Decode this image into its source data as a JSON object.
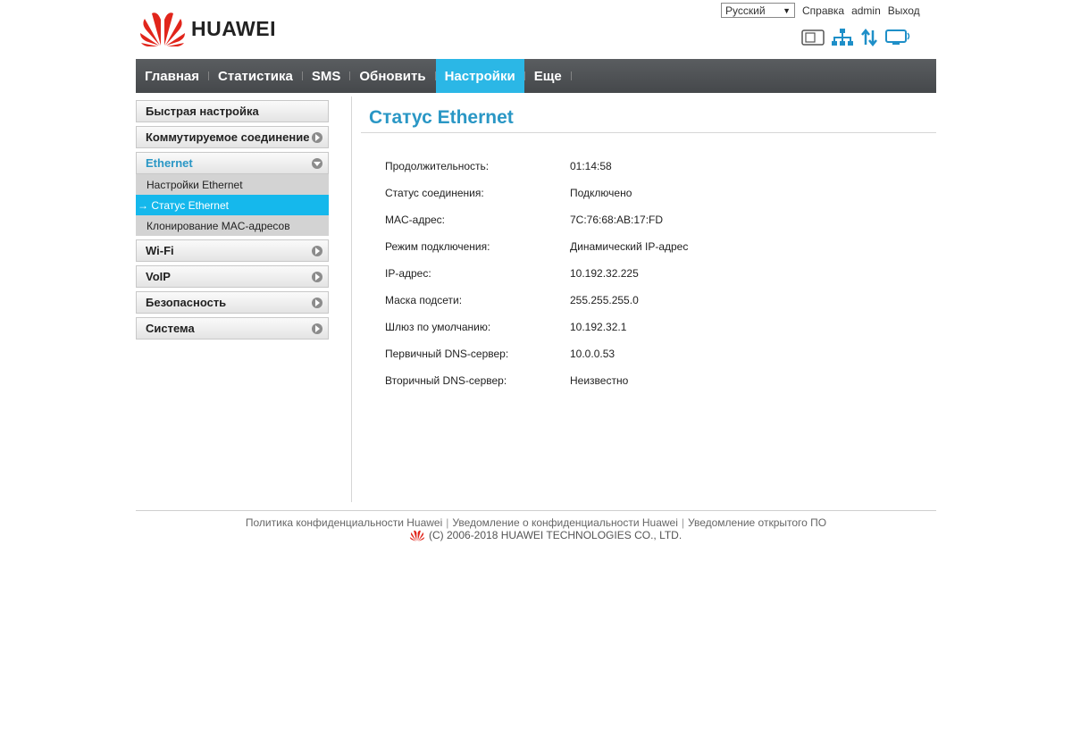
{
  "header": {
    "brand": "HUAWEI",
    "language": "Русский",
    "help_label": "Справка",
    "user_label": "admin",
    "logout_label": "Выход"
  },
  "nav": {
    "items": [
      {
        "label": "Главная"
      },
      {
        "label": "Статистика"
      },
      {
        "label": "SMS"
      },
      {
        "label": "Обновить"
      },
      {
        "label": "Настройки",
        "active": true
      },
      {
        "label": "Еще"
      }
    ]
  },
  "sidebar": {
    "quick_setup": "Быстрая настройка",
    "dialup": "Коммутируемое соединение",
    "ethernet": "Ethernet",
    "ethernet_sub": [
      "Настройки Ethernet",
      "→ Статус Ethernet",
      "Клонирование MAC-адресов"
    ],
    "wifi": "Wi-Fi",
    "voip": "VoIP",
    "security": "Безопасность",
    "system": "Система"
  },
  "content": {
    "title": "Статус Ethernet",
    "rows": [
      {
        "label": "Продолжительность:",
        "value": "01:14:58"
      },
      {
        "label": "Статус соединения:",
        "value": "Подключено"
      },
      {
        "label": "MAC-адрес:",
        "value": "7C:76:68:AB:17:FD"
      },
      {
        "label": "Режим подключения:",
        "value": "Динамический IP-адрес"
      },
      {
        "label": "IP-адрес:",
        "value": "10.192.32.225"
      },
      {
        "label": "Маска подсети:",
        "value": "255.255.255.0"
      },
      {
        "label": "Шлюз по умолчанию:",
        "value": "10.192.32.1"
      },
      {
        "label": "Первичный DNS-сервер:",
        "value": "10.0.0.53"
      },
      {
        "label": "Вторичный DNS-сервер:",
        "value": "Неизвестно"
      }
    ]
  },
  "footer": {
    "privacy_policy": "Политика конфиденциальности Huawei",
    "privacy_notice": "Уведомление о конфиденциальности Huawei",
    "open_source": "Уведомление открытого ПО",
    "copyright": "(C) 2006-2018 HUAWEI TECHNOLOGIES CO., LTD."
  },
  "colors": {
    "accent": "#2bb7e6",
    "title": "#2a97c5",
    "brand_red": "#e1251b",
    "nav_bg": "#505356"
  },
  "icons": [
    "sim-card-icon",
    "network-icon",
    "data-transfer-icon",
    "wifi-device-icon"
  ]
}
